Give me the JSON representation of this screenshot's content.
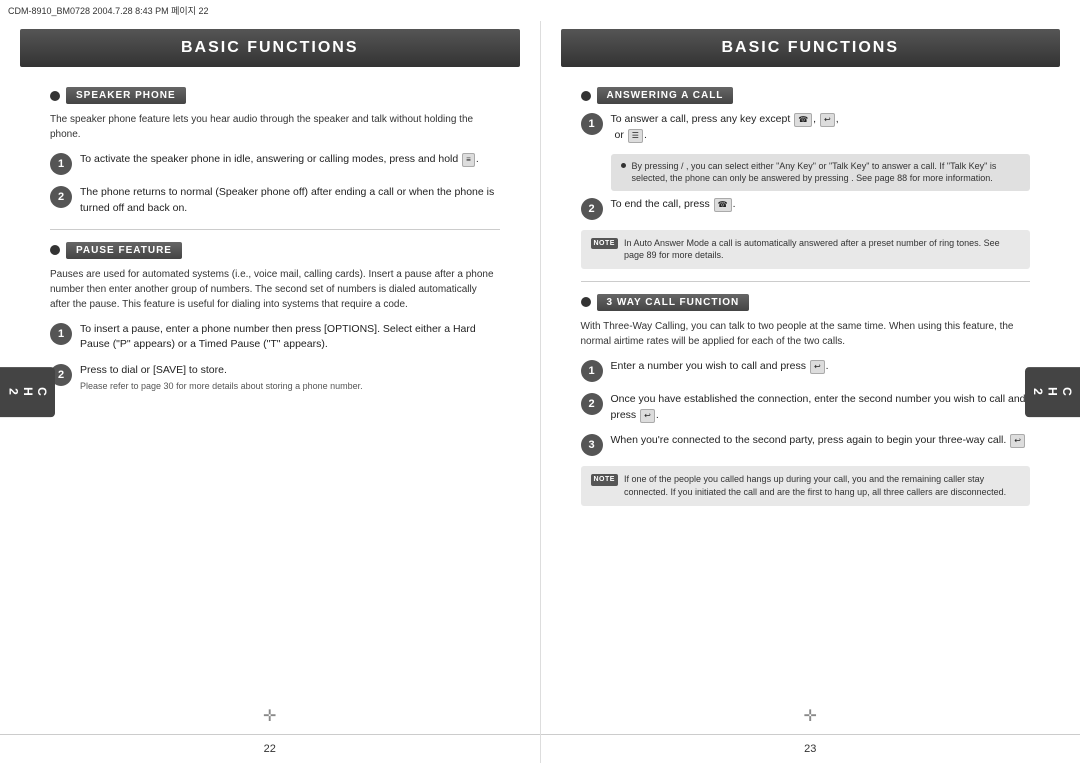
{
  "topbar": {
    "text": "CDM-8910_BM0728  2004.7.28 8:43 PM  페이지 22"
  },
  "left_page": {
    "title": "BASIC FUNCTIONS",
    "chapter": {
      "line1": "C",
      "line2": "H",
      "line3": "2"
    },
    "page_number": "22",
    "sections": {
      "speaker_phone": {
        "title": "SPEAKER PHONE",
        "intro": "The speaker phone feature lets you hear audio through the speaker and talk without holding the phone.",
        "steps": [
          {
            "number": "1",
            "text": "To activate the speaker phone in idle, answering or calling modes, press and hold"
          },
          {
            "number": "2",
            "text": "The phone returns to normal (Speaker phone off) after ending a call or when the phone is turned off and back on."
          }
        ]
      },
      "pause_feature": {
        "title": "PAUSE FEATURE",
        "intro": "Pauses are used for automated systems (i.e., voice mail, calling cards). Insert a pause after a phone number then enter another group of numbers. The second set of numbers is dialed automatically after the pause. This feature is useful for dialing into systems that require a code.",
        "steps": [
          {
            "number": "1",
            "text": "To insert a pause, enter a phone number then press [OPTIONS]. Select either a Hard Pause (\"P\" appears) or a Timed Pause (\"T\" appears)."
          },
          {
            "number": "2",
            "text": "Press to dial or [SAVE] to store.",
            "sub": "Please refer to page 30 for more details about storing a phone number."
          }
        ]
      }
    }
  },
  "right_page": {
    "title": "BASIC FUNCTIONS",
    "chapter": {
      "line1": "C",
      "line2": "H",
      "line3": "2"
    },
    "page_number": "23",
    "sections": {
      "answering_call": {
        "title": "ANSWERING A CALL",
        "steps": [
          {
            "number": "1",
            "text": "To answer a call, press any key except",
            "note": {
              "bullet": "By pressing  /        , you can select either \"Any Key\" or \"Talk Key\" to answer a call. If \"Talk Key\" is selected, the phone can only be answered by pressing . See page 88 for more information."
            }
          },
          {
            "number": "2",
            "text": "To end the call, press"
          }
        ],
        "note": "In Auto Answer Mode a call is automatically answered after a preset number of ring tones. See page 89 for more details."
      },
      "three_way": {
        "title": "3 WAY CALL FUNCTION",
        "intro": "With Three-Way Calling, you can talk to two people at the same time. When using this feature, the normal airtime rates will be applied for each of the two calls.",
        "steps": [
          {
            "number": "1",
            "text": "Enter a number you wish to call and press"
          },
          {
            "number": "2",
            "text": "Once you have established the connection, enter the second number you wish to call and press"
          },
          {
            "number": "3",
            "text": "When you're connected to the second party, press again to begin your three-way call."
          }
        ],
        "note": "If one of the people you called hangs up during your call, you and the remaining caller stay connected. If you initiated the call and are the first to hang up, all three callers are disconnected."
      }
    }
  }
}
